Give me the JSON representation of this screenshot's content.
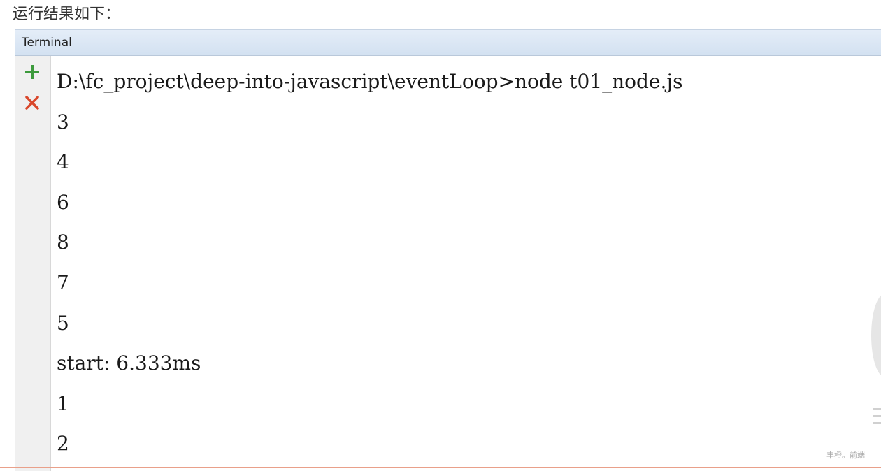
{
  "caption": "运行结果如下：",
  "terminal": {
    "title": "Terminal",
    "add_icon": "plus-icon",
    "close_icon": "close-icon",
    "accent_add": "#3c9a3c",
    "accent_close": "#d9472b",
    "lines": [
      "D:\\fc_project\\deep-into-javascript\\eventLoop>node t01_node.js",
      "3",
      "4",
      "6",
      "8",
      "7",
      "5",
      "start: 6.333ms",
      "1",
      "2"
    ]
  },
  "watermark": {
    "text": "丰橙。前端"
  }
}
